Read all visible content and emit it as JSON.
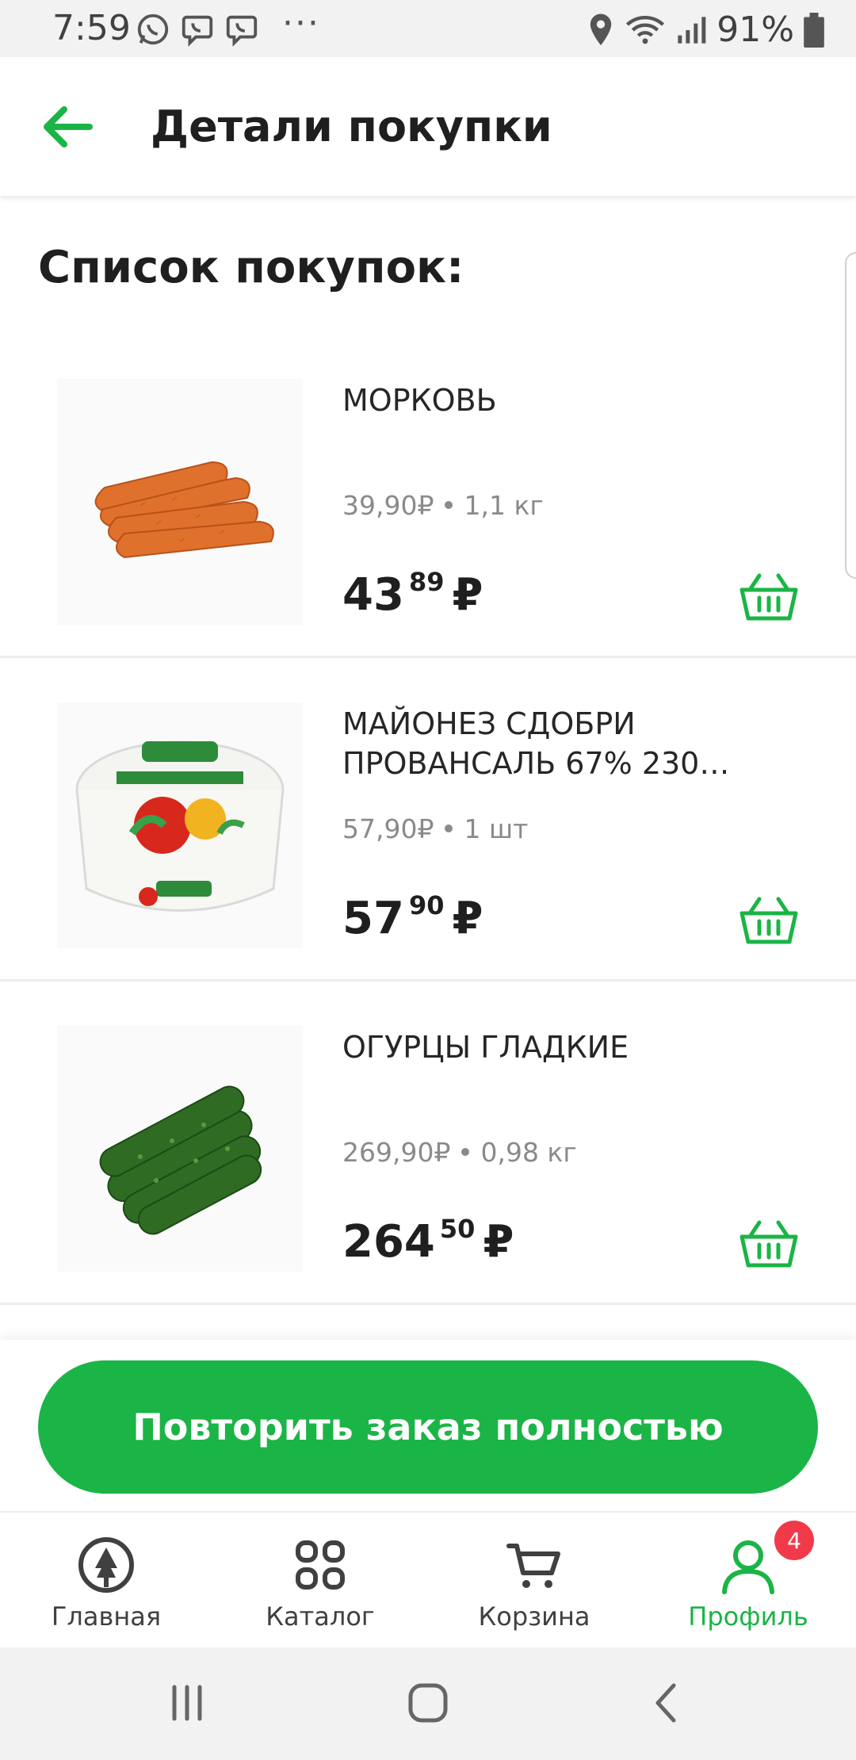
{
  "status_bar": {
    "time": "7:59",
    "battery": "91%",
    "icons": [
      "whatsapp-icon",
      "viber-icon",
      "viber-icon",
      "more-dots-icon",
      "location-icon",
      "wifi-icon",
      "signal-icon",
      "battery-icon"
    ]
  },
  "header": {
    "title": "Детали покупки",
    "back_icon": "arrow-left-icon"
  },
  "list_title": "Список покупок:",
  "items": [
    {
      "name": "МОРКОВЬ",
      "unit_price": "39,90₽",
      "quantity": "1,1 кг",
      "price_main": "43",
      "price_kop": "89",
      "currency": "₽",
      "image": "carrots"
    },
    {
      "name": "МАЙОНЕЗ СДОБРИ ПРОВАНСАЛЬ 67% 230…",
      "unit_price": "57,90₽",
      "quantity": "1 шт",
      "price_main": "57",
      "price_kop": "90",
      "currency": "₽",
      "image": "mayonnaise"
    },
    {
      "name": "ОГУРЦЫ ГЛАДКИЕ",
      "unit_price": "269,90₽",
      "quantity": "0,98 кг",
      "price_main": "264",
      "price_kop": "50",
      "currency": "₽",
      "image": "cucumbers"
    }
  ],
  "repeat_button": "Повторить заказ полностью",
  "nav": [
    {
      "label": "Главная",
      "icon": "home-logo-icon"
    },
    {
      "label": "Каталог",
      "icon": "catalog-grid-icon"
    },
    {
      "label": "Корзина",
      "icon": "cart-icon"
    },
    {
      "label": "Профиль",
      "icon": "profile-icon",
      "badge": "4",
      "active": true
    }
  ],
  "colors": {
    "accent": "#1bb446",
    "badge": "#f03a4a",
    "text": "#1f1f1f",
    "muted": "#8a8a8a"
  }
}
